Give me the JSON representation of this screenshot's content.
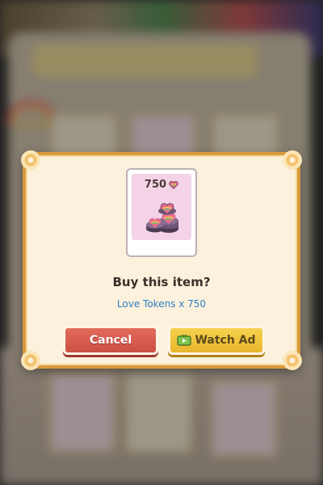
{
  "dialog": {
    "item": {
      "price": "750",
      "currency_icon": "rainbow-heart-icon",
      "image_icon": "heart-tokens-stack-icon"
    },
    "title": "Buy this item?",
    "subtitle": "Love Tokens x 750",
    "buttons": {
      "cancel_label": "Cancel",
      "watch_ad_label": "Watch Ad",
      "watch_ad_icon": "tv-icon"
    }
  },
  "colors": {
    "dialog_border": "#d99a3c",
    "dialog_bg": "#fbf1dc",
    "cancel_button": "#cc4f44",
    "watch_ad_button": "#e8b62c",
    "subtitle_text": "#2f7fc6"
  }
}
